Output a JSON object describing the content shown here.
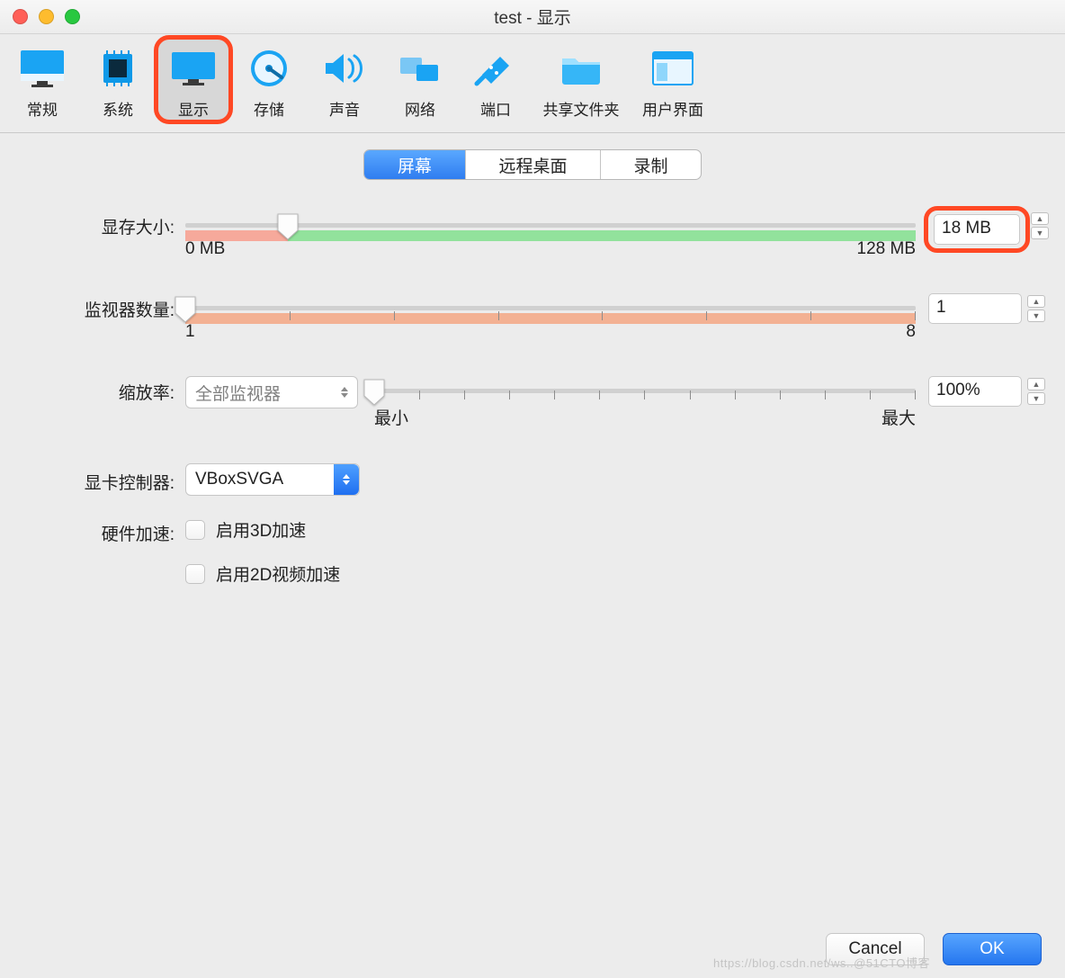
{
  "window": {
    "title": "test - 显示"
  },
  "toolbar": [
    {
      "id": "general",
      "label": "常规"
    },
    {
      "id": "system",
      "label": "系统"
    },
    {
      "id": "display",
      "label": "显示",
      "selected": true
    },
    {
      "id": "storage",
      "label": "存储"
    },
    {
      "id": "audio",
      "label": "声音"
    },
    {
      "id": "network",
      "label": "网络"
    },
    {
      "id": "ports",
      "label": "端口"
    },
    {
      "id": "shared",
      "label": "共享文件夹"
    },
    {
      "id": "ui",
      "label": "用户界面"
    }
  ],
  "tabs": [
    {
      "id": "screen",
      "label": "屏幕",
      "active": true
    },
    {
      "id": "remote",
      "label": "远程桌面"
    },
    {
      "id": "record",
      "label": "录制"
    }
  ],
  "videoMemory": {
    "label": "显存大小:",
    "min_label": "0 MB",
    "max_label": "128 MB",
    "value": "18 MB",
    "thumb_pct": 14,
    "red_end_pct": 14,
    "green_end_pct": 100
  },
  "monitors": {
    "label": "监视器数量:",
    "min_label": "1",
    "max_label": "8",
    "value": "1",
    "thumb_pct": 0
  },
  "scale": {
    "label": "缩放率:",
    "dropdown_value": "全部监视器",
    "min_label": "最小",
    "max_label": "最大",
    "value": "100%",
    "thumb_pct": 0
  },
  "controller": {
    "label": "显卡控制器:",
    "value": "VBoxSVGA"
  },
  "accel": {
    "label": "硬件加速:",
    "cb3d": "启用3D加速",
    "cb2d": "启用2D视频加速"
  },
  "buttons": {
    "cancel": "Cancel",
    "ok": "OK"
  },
  "watermark": "https://blog.csdn.net/ws..@51CTO博客"
}
